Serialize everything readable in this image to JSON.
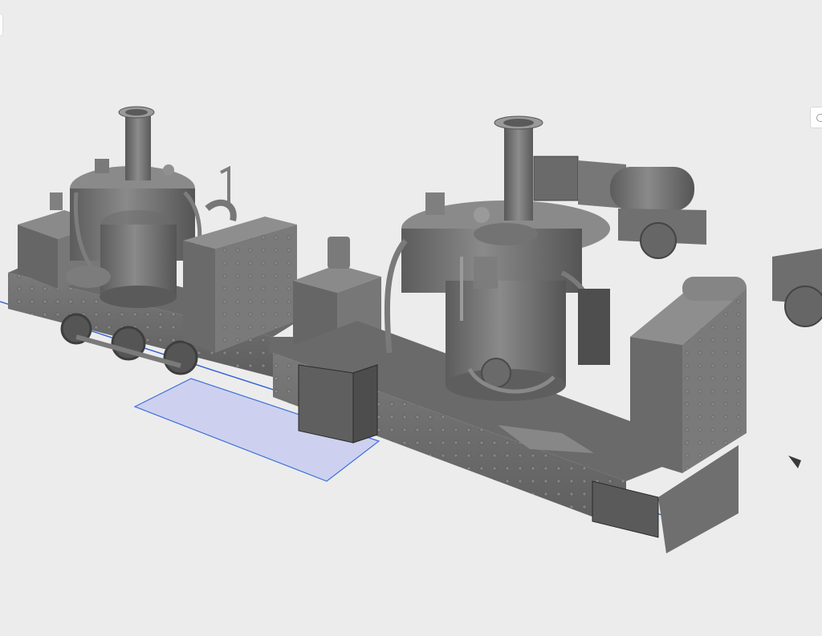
{
  "viewport": {
    "background": "#ececec",
    "model_color": "#6e6e6e",
    "selection_fill": "#c8cdf0",
    "selection_stroke": "#3a6fd8",
    "axis_color": "#2f5fd6"
  },
  "panels": {
    "left_tab_icon": "panel-toggle-icon",
    "right_tab_icon": "orbit-icon"
  }
}
